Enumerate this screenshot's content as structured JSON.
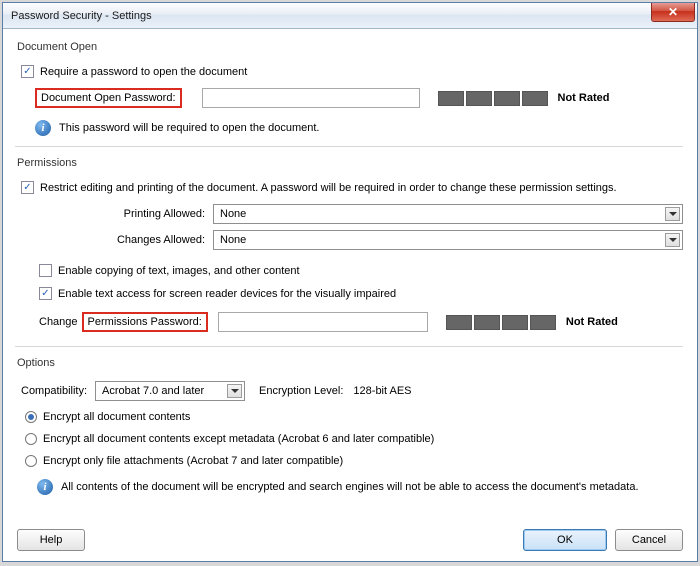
{
  "window": {
    "title": "Password Security - Settings"
  },
  "docOpen": {
    "groupTitle": "Document Open",
    "requireLabel": "Require a password to open the document",
    "passwordLabel": "Document Open Password:",
    "passwordValue": "",
    "rating": "Not Rated",
    "infoText": "This password will be required to open the document."
  },
  "permissions": {
    "groupTitle": "Permissions",
    "restrictLabel": "Restrict editing and printing of the document. A password will be required in order to change these permission settings.",
    "printingLabel": "Printing Allowed:",
    "printingValue": "None",
    "changesLabel": "Changes Allowed:",
    "changesValue": "None",
    "enableCopyLabel": "Enable copying of text, images, and other content",
    "enableScreenReaderLabel": "Enable text access for screen reader devices for the visually impaired",
    "changePwdPrefix": "Change",
    "changePwdLabel": "Permissions Password:",
    "changePwdValue": "",
    "rating": "Not Rated"
  },
  "options": {
    "groupTitle": "Options",
    "compatibilityLabel": "Compatibility:",
    "compatibilityValue": "Acrobat 7.0 and later",
    "encryptionLevelLabel": "Encryption Level:",
    "encryptionLevelValue": "128-bit AES",
    "radioAll": "Encrypt all document contents",
    "radioExceptMeta": "Encrypt all document contents except metadata (Acrobat 6 and later compatible)",
    "radioAttachments": "Encrypt only file attachments (Acrobat 7 and later compatible)",
    "infoText": "All contents of the document will be encrypted and search engines will not be able to access the document's metadata."
  },
  "buttons": {
    "help": "Help",
    "ok": "OK",
    "cancel": "Cancel"
  }
}
